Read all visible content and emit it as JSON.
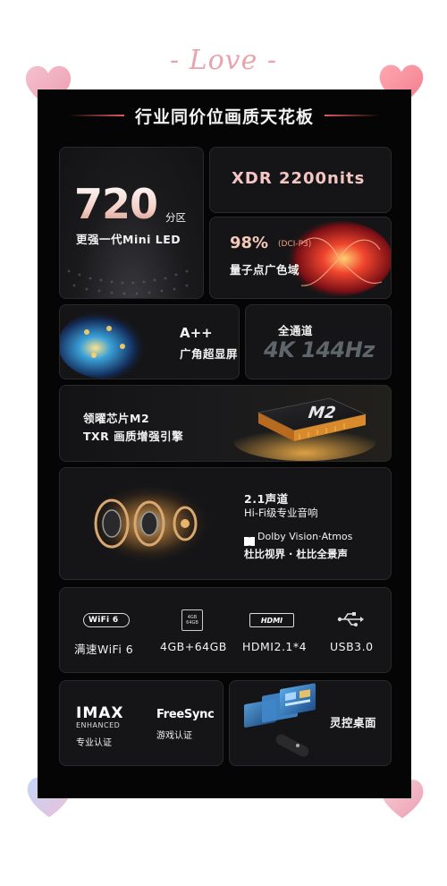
{
  "decor": {
    "love_text": "- Love -"
  },
  "header": {
    "title": "行业同价位画质天花板"
  },
  "cards": {
    "mini_led": {
      "number": "720",
      "unit": "分区",
      "caption": "更强一代Mini LED"
    },
    "xdr": {
      "label": "XDR 2200nits"
    },
    "gamut": {
      "percent": "98%",
      "standard": "(DCI-P3)",
      "caption": "量子点广色域"
    },
    "wide_angle": {
      "grade": "A++",
      "caption": "广角超显屏"
    },
    "refresh": {
      "label": "全通道",
      "value": "4K 144Hz"
    },
    "chip": {
      "line1": "领曜芯片M2",
      "line2": "TXR 画质增强引擎",
      "badge": "M2"
    },
    "audio": {
      "title": "2.1声道",
      "subtitle": "Hi-Fi级专业音响",
      "dolby": "Dolby Vision·Atmos",
      "dolby_cn": "杜比视界 · 杜比全景声"
    },
    "connectivity": [
      {
        "icon": "wifi6-icon",
        "badge": "WiFi 6",
        "label": "满速WiFi 6"
      },
      {
        "icon": "memory-chip-icon",
        "badge": "4GB 64GB",
        "label": "4GB+64GB"
      },
      {
        "icon": "hdmi-icon",
        "badge": "HDMI",
        "label": "HDMI2.1*4"
      },
      {
        "icon": "usb-icon",
        "label": "USB3.0"
      }
    ],
    "certs": {
      "imax": "IMAX",
      "imax_sub": "ENHANCED",
      "imax_caption": "专业认证",
      "freesync": "FreeSync",
      "freesync_caption": "游戏认证"
    },
    "desktop": {
      "label": "灵控桌面"
    }
  },
  "colors": {
    "panel": "#050505",
    "accent_red": "#e25a5f",
    "heart_pink": "#ef8fa4",
    "heart_blue": "#a9c4f0"
  }
}
